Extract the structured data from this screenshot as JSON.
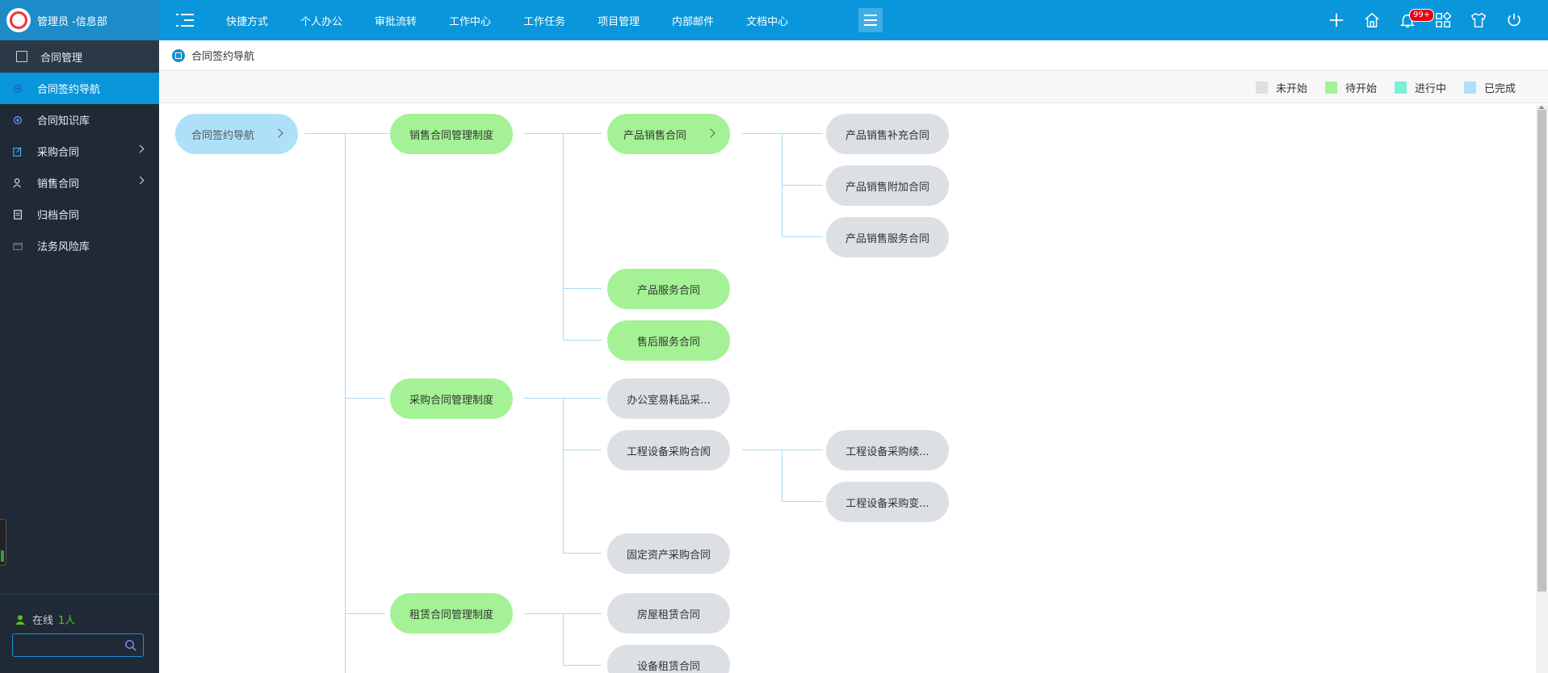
{
  "header": {
    "user_title": "管理员 -信息部",
    "nav": [
      "快捷方式",
      "个人办公",
      "审批流转",
      "工作中心",
      "工作任务",
      "项目管理",
      "内部邮件",
      "文档中心"
    ],
    "notify_badge": "99+",
    "icons": [
      "plus-icon",
      "home-icon",
      "bell-icon",
      "apps-icon",
      "skin-icon",
      "power-icon"
    ]
  },
  "sidebar": {
    "section": "合同管理",
    "items": [
      {
        "label": "合同签约导航",
        "icon": "gear-icon",
        "active": true,
        "arrow": false
      },
      {
        "label": "合同知识库",
        "icon": "gear-icon",
        "active": false,
        "arrow": false
      },
      {
        "label": "采购合同",
        "icon": "edit-icon",
        "active": false,
        "arrow": true
      },
      {
        "label": "销售合同",
        "icon": "user-icon",
        "active": false,
        "arrow": true
      },
      {
        "label": "归档合同",
        "icon": "archive-icon",
        "active": false,
        "arrow": false
      },
      {
        "label": "法务风险库",
        "icon": "folder-icon",
        "active": false,
        "arrow": false
      }
    ],
    "online_label": "在线",
    "online_count": "1人",
    "search_placeholder": ""
  },
  "breadcrumb": "合同签约导航",
  "legend": [
    {
      "label": "未开始",
      "color": "#dcdfe3"
    },
    {
      "label": "待开始",
      "color": "#a4f295"
    },
    {
      "label": "进行中",
      "color": "#7af1d6"
    },
    {
      "label": "已完成",
      "color": "#aee0fa"
    }
  ],
  "tree": {
    "root": {
      "label": "合同签约导航",
      "status": "done"
    },
    "groups": [
      {
        "label": "销售合同管理制度",
        "status": "pending",
        "children": [
          {
            "label": "产品销售合同",
            "status": "pending",
            "children": [
              {
                "label": "产品销售补充合同",
                "status": "nstart"
              },
              {
                "label": "产品销售附加合同",
                "status": "nstart"
              },
              {
                "label": "产品销售服务合同",
                "status": "nstart"
              }
            ]
          },
          {
            "label": "产品服务合同",
            "status": "pending"
          },
          {
            "label": "售后服务合同",
            "status": "pending"
          }
        ]
      },
      {
        "label": "采购合同管理制度",
        "status": "pending",
        "children": [
          {
            "label": "办公室易耗品采...",
            "status": "nstart"
          },
          {
            "label": "工程设备采购合阂",
            "status": "nstart",
            "children": [
              {
                "label": "工程设备采购续...",
                "status": "nstart"
              },
              {
                "label": "工程设备采购变...",
                "status": "nstart"
              }
            ]
          },
          {
            "label": "固定资产采购合同",
            "status": "nstart"
          }
        ]
      },
      {
        "label": "租赁合同管理制度",
        "status": "pending",
        "children": [
          {
            "label": "房屋租赁合同",
            "status": "nstart"
          },
          {
            "label": "设备租赁合同",
            "status": "nstart"
          }
        ]
      }
    ]
  }
}
